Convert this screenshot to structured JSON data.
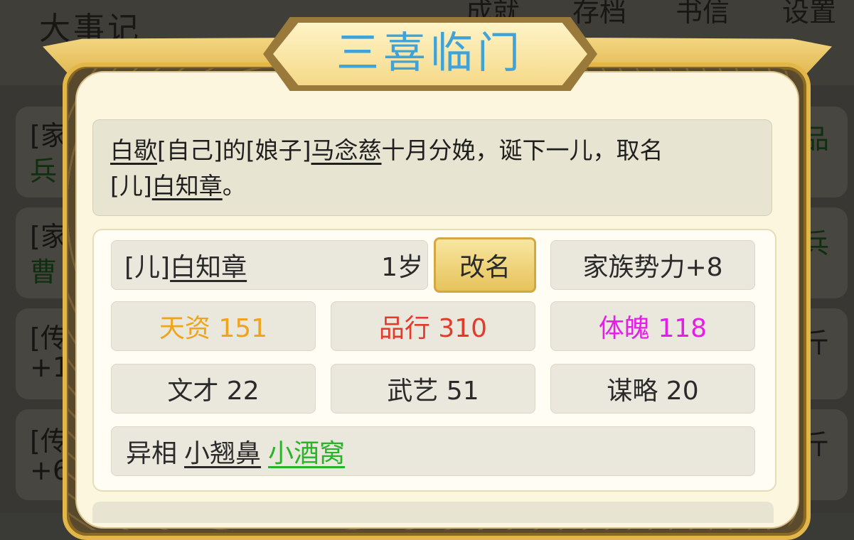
{
  "background": {
    "title": "大事记",
    "menu": [
      "成就",
      "存档",
      "书信",
      "设置"
    ],
    "side_left": [
      "[家",
      "兵",
      "[家",
      "曹",
      "[传",
      "+1",
      "[传",
      "+6"
    ],
    "side_right": [
      "品",
      "兵",
      "斤",
      "斤"
    ]
  },
  "dialog": {
    "title": "三喜临门",
    "story": {
      "p1_name": "白歇",
      "p1_tag": "[自己]的[娘子]",
      "p2_name": "马念慈",
      "p2_text": "十月分娩，诞下一儿，取名",
      "child_tag": "[儿]",
      "child_name": "白知章",
      "end": "。"
    },
    "child": {
      "tag": "[儿]",
      "name": "白知章",
      "age": "1岁",
      "rename_label": "改名",
      "family_power": "家族势力+8"
    },
    "stats": {
      "talent": "天资 151",
      "conduct": "品行 310",
      "physique": "体魄 118",
      "literary": "文才 22",
      "martial": "武艺 51",
      "strategy": "谋略 20"
    },
    "traits": {
      "label": "异相",
      "trait1": "小翘鼻",
      "trait2": "小酒窝"
    }
  },
  "colors": {
    "title": "#3fa3d9",
    "talent": "#f0a31c",
    "conduct": "#e33a2c",
    "physique": "#e41ee6",
    "trait_green": "#27b427"
  }
}
